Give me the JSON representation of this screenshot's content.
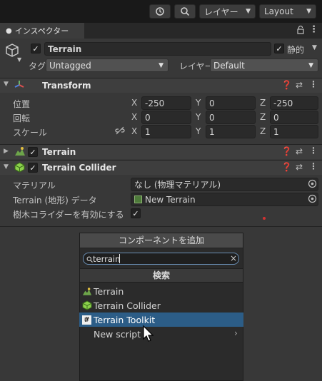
{
  "toolbar": {
    "layer_label": "レイヤー",
    "layout_label": "Layout"
  },
  "tab": {
    "title": "インスペクター"
  },
  "object": {
    "name": "Terrain",
    "static_label": "静的",
    "tag_label": "タグ",
    "tag_value": "Untagged",
    "layer_label": "レイヤー",
    "layer_value": "Default"
  },
  "transform": {
    "title": "Transform",
    "position_label": "位置",
    "rotation_label": "回転",
    "scale_label": "スケール",
    "axis_x": "X",
    "axis_y": "Y",
    "axis_z": "Z",
    "position": {
      "x": "-250",
      "y": "0",
      "z": "-250"
    },
    "rotation": {
      "x": "0",
      "y": "0",
      "z": "0"
    },
    "scale": {
      "x": "1",
      "y": "1",
      "z": "1"
    }
  },
  "terrain_component": {
    "title": "Terrain"
  },
  "terrain_collider": {
    "title": "Terrain Collider",
    "material_label": "マテリアル",
    "material_value": "なし (物理マテリアル)",
    "data_label": "Terrain (地形) データ",
    "data_value": "New Terrain",
    "tree_label": "樹木コライダーを有効にする"
  },
  "add_component": {
    "title": "コンポーネントを追加",
    "search_value": "terrain",
    "results_header": "検索",
    "items": [
      "Terrain",
      "Terrain Collider",
      "Terrain Toolkit",
      "New script"
    ]
  },
  "colors": {
    "accent": "#2c5d87",
    "background": "#383838"
  },
  "icons": [
    "history-icon",
    "search-icon",
    "lock-icon",
    "kebab-icon",
    "cube-icon",
    "help-icon",
    "preset-icon",
    "link-icon",
    "object-picker-icon",
    "terrain-icon",
    "collider-icon",
    "script-icon",
    "chevron-right-icon",
    "clear-icon",
    "mouse-cursor-icon"
  ]
}
